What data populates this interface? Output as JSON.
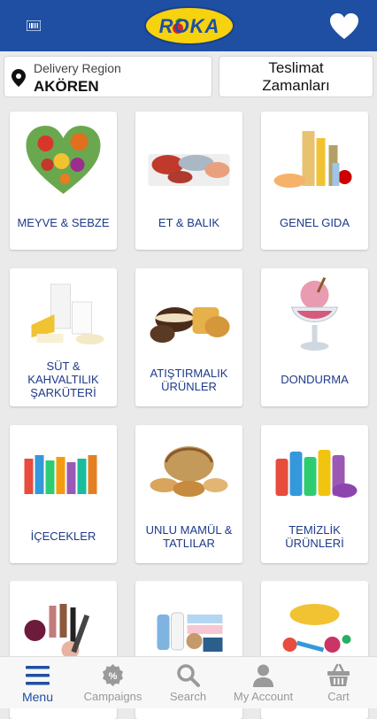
{
  "header": {
    "logo_text": "ROKA",
    "barcode_icon": "barcode-icon",
    "favorite_icon": "heart-icon",
    "bg_color": "#1e4fa3",
    "logo_color": "#f6d20f"
  },
  "region": {
    "label": "Delivery Region",
    "value": "AKÖREN",
    "icon": "location-pin-icon"
  },
  "delivery_times": {
    "label": "Teslimat\nZamanları"
  },
  "categories": [
    {
      "label": "MEYVE & SEBZE",
      "image": "fruits-vegetables-heart"
    },
    {
      "label": "ET & BALIK",
      "image": "meat-fish"
    },
    {
      "label": "GENEL GIDA",
      "image": "general-food"
    },
    {
      "label": "SÜT &\nKAHVALTILIK\nŞARKÜTERİ",
      "image": "dairy-breakfast"
    },
    {
      "label": "ATIŞTIRMALIK\nÜRÜNLER",
      "image": "snacks"
    },
    {
      "label": "DONDURMA",
      "image": "ice-cream"
    },
    {
      "label": "İÇECEKLER",
      "image": "beverages"
    },
    {
      "label": "UNLU MAMÜL &\nTATLILAR",
      "image": "bakery"
    },
    {
      "label": "TEMİZLİK\nÜRÜNLERİ",
      "image": "cleaning"
    },
    {
      "label": "",
      "image": "cosmetics"
    },
    {
      "label": "",
      "image": "baby-products"
    },
    {
      "label": "",
      "image": "pet-products"
    }
  ],
  "tabbar": {
    "active_color": "#1e4fa3",
    "items": [
      {
        "label": "Menu",
        "icon": "menu-icon",
        "active": true
      },
      {
        "label": "Campaigns",
        "icon": "percent-badge-icon",
        "active": false
      },
      {
        "label": "Search",
        "icon": "search-icon",
        "active": false
      },
      {
        "label": "My Account",
        "icon": "user-icon",
        "active": false
      },
      {
        "label": "Cart",
        "icon": "basket-icon",
        "active": false
      }
    ]
  }
}
